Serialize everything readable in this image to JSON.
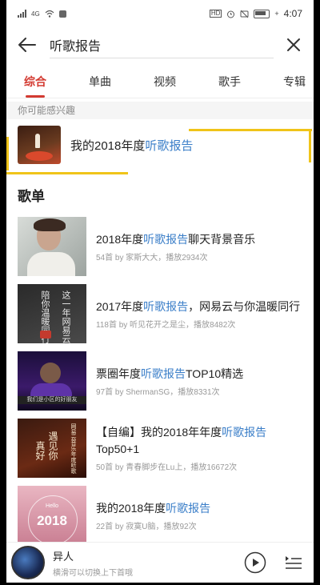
{
  "status_bar": {
    "left_text": "4G",
    "time": "4:07"
  },
  "search": {
    "query": "听歌报告"
  },
  "tabs": [
    "综合",
    "单曲",
    "视频",
    "歌手",
    "专辑"
  ],
  "active_tab": 0,
  "suggestion": {
    "header": "你可能感兴趣",
    "title_prefix": "我的2018年度",
    "title_highlight": "听歌报告"
  },
  "playlists_section": {
    "title": "歌单",
    "items": [
      {
        "title_pre": "2018年度",
        "title_hl": "听歌报告",
        "title_post": "聊天背景音乐",
        "meta": "54首  by 家斯大大，播放2934次"
      },
      {
        "title_pre": "2017年度",
        "title_hl": "听歌报告",
        "title_post": "，网易云与你温暖同行",
        "meta": "118首  by 听见花开之是尘，播放8482次"
      },
      {
        "title_pre": "票圈年度",
        "title_hl": "听歌报告",
        "title_post": "TOP10精选",
        "meta": "97首  by ShermanSG，播放8331次"
      },
      {
        "title_pre": "【自编】我的2018年年度",
        "title_hl": "听歌报告",
        "title_post": "Top50+1",
        "meta": "50首  by 青春脚步在Lu上，播放16672次"
      },
      {
        "title_pre": "我的2018年度",
        "title_hl": "听歌报告",
        "title_post": "",
        "meta": "22首  by 寂寞U脑，播放92次"
      }
    ]
  },
  "covers": {
    "c2_lines": [
      "陪你温暖同行",
      "这一年网易云"
    ],
    "c3_strip": "我们是小区的好朋友",
    "c4_lines": [
      "遇见你",
      "真好"
    ],
    "c4_side": "网易云音乐年度听歌",
    "c5_small": "Hello",
    "c5_year": "2018"
  },
  "player": {
    "title": "异人",
    "subtitle": "横滑可以切换上下首哦"
  }
}
